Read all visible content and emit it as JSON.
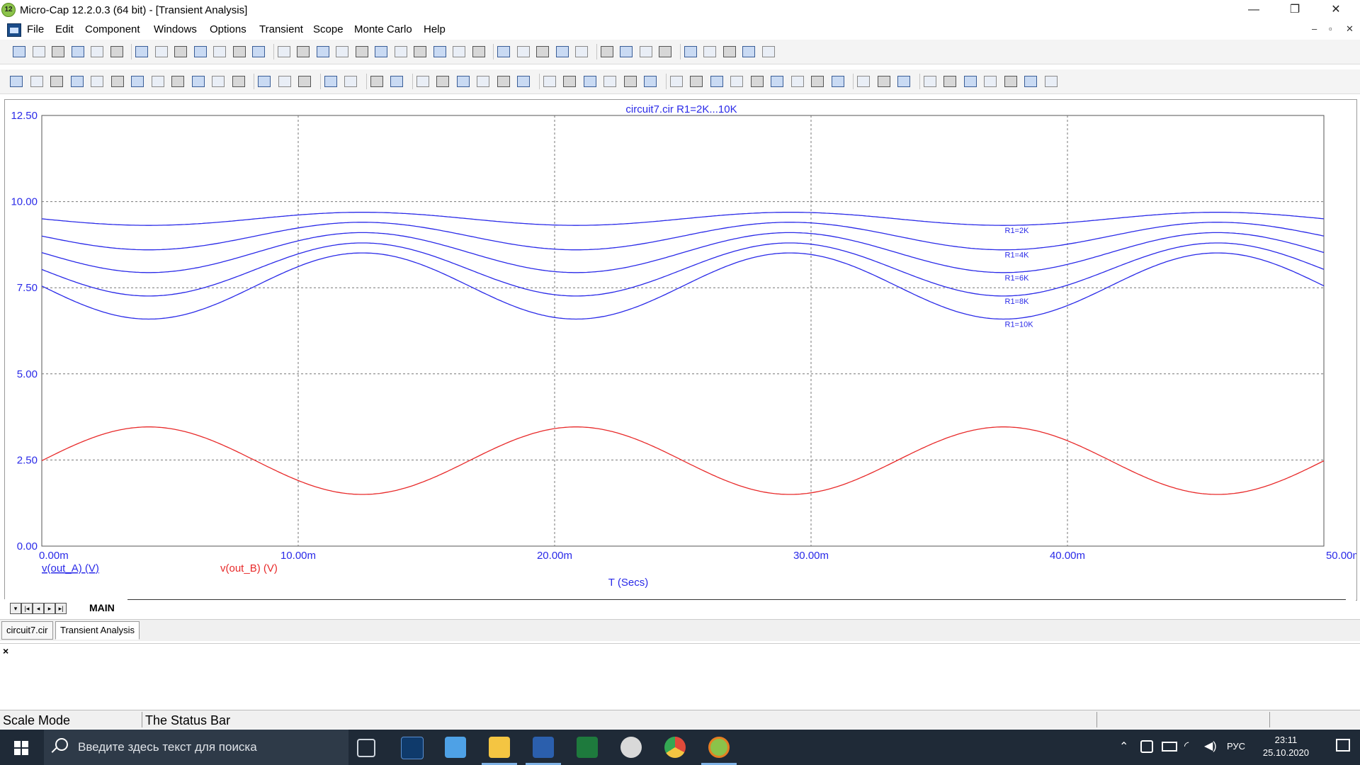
{
  "window": {
    "title": "Micro-Cap 12.2.0.3 (64 bit) - [Transient Analysis]",
    "app_badge": "12",
    "controls": {
      "minimize": "—",
      "restore": "❐",
      "close": "✕"
    }
  },
  "menu": {
    "items": [
      "File",
      "Edit",
      "Component",
      "Windows",
      "Options",
      "Transient",
      "Scope",
      "Monte Carlo",
      "Help"
    ],
    "mdi": {
      "minimize": "–",
      "restore": "▫",
      "close": "✕"
    }
  },
  "chart_data": {
    "type": "line",
    "title": "circuit7.cir R1=2K...10K",
    "xlabel": "T (Secs)",
    "x_ticks": [
      "0.00m",
      "10.00m",
      "20.00m",
      "30.00m",
      "40.00m",
      "50.00m"
    ],
    "y_ticks": [
      "0.00",
      "2.50",
      "5.00",
      "7.50",
      "10.00",
      "12.50"
    ],
    "xlim": [
      0,
      0.05
    ],
    "ylim": [
      0,
      12.5
    ],
    "grid": true,
    "colors": {
      "out_A": "#2a2ae8",
      "out_B": "#e82a2a",
      "text": "#2a2ae8"
    },
    "legend": [
      {
        "label": "v(out_A) (V)",
        "color": "#2a2ae8"
      },
      {
        "label": "v(out_B) (V)",
        "color": "#e82a2a"
      }
    ],
    "series": [
      {
        "name": "R1=2K",
        "expression": "v(out_A)",
        "mean": 9.5,
        "amplitude": 0.19,
        "x": [
          0,
          0.00417,
          0.0125,
          0.02083,
          0.02917,
          0.0375,
          0.04583,
          0.05
        ],
        "y": [
          9.5,
          9.31,
          9.69,
          9.31,
          9.69,
          9.31,
          9.69,
          9.5
        ]
      },
      {
        "name": "R1=4K",
        "expression": "v(out_A)",
        "mean": 9.0,
        "amplitude": 0.4,
        "x": [
          0,
          0.00417,
          0.0125,
          0.02083,
          0.02917,
          0.0375,
          0.04583,
          0.05
        ],
        "y": [
          9.0,
          8.6,
          9.4,
          8.6,
          9.4,
          8.6,
          9.4,
          9.0
        ]
      },
      {
        "name": "R1=6K",
        "expression": "v(out_A)",
        "mean": 8.52,
        "amplitude": 0.58,
        "x": [
          0,
          0.00417,
          0.0125,
          0.02083,
          0.02917,
          0.0375,
          0.04583,
          0.05
        ],
        "y": [
          8.52,
          7.94,
          9.1,
          7.94,
          9.1,
          7.94,
          9.1,
          8.52
        ]
      },
      {
        "name": "R1=8K",
        "expression": "v(out_A)",
        "mean": 8.03,
        "amplitude": 0.77,
        "x": [
          0,
          0.00417,
          0.0125,
          0.02083,
          0.02917,
          0.0375,
          0.04583,
          0.05
        ],
        "y": [
          8.03,
          7.26,
          8.8,
          7.26,
          8.8,
          7.26,
          8.8,
          8.03
        ]
      },
      {
        "name": "R1=10K",
        "expression": "v(out_A)",
        "mean": 7.55,
        "amplitude": 0.96,
        "x": [
          0,
          0.00417,
          0.0125,
          0.02083,
          0.02917,
          0.0375,
          0.04583,
          0.05
        ],
        "y": [
          7.55,
          6.59,
          8.51,
          6.59,
          8.51,
          6.59,
          8.51,
          7.55
        ]
      },
      {
        "name": "v(out_B)",
        "expression": "v(out_B)",
        "mean": 2.48,
        "amplitude": 0.98,
        "x": [
          0,
          0.00417,
          0.0125,
          0.02083,
          0.02917,
          0.0375,
          0.04583,
          0.05
        ],
        "y": [
          2.48,
          3.46,
          1.5,
          3.46,
          1.5,
          3.46,
          1.5,
          2.48
        ]
      }
    ],
    "period_s": 0.01667
  },
  "tabs": {
    "main_label": "MAIN",
    "documents": [
      "circuit7.cir",
      "Transient Analysis"
    ]
  },
  "output_pane": {
    "close": "×"
  },
  "status": {
    "mode": "Scale Mode",
    "message": "The Status Bar"
  },
  "taskbar": {
    "search_placeholder": "Введите здесь текст для поиска",
    "language": "РУС",
    "time": "23:11",
    "date": "25.10.2020"
  },
  "icons": {
    "toolbar1": [
      "new-file-icon",
      "open-icon",
      "save-icon",
      "save-all-icon",
      "print-preview-icon",
      "print-icon",
      "undo-icon",
      "redo-icon",
      "cut-icon",
      "copy-icon",
      "paste-icon",
      "delete-icon",
      "select-all-icon",
      "ground-icon",
      "resistor-icon",
      "capacitor-icon",
      "inductor-icon",
      "diode-icon",
      "transistor-icon",
      "battery-icon",
      "opamp-icon",
      "source-icon",
      "wire-icon",
      "node-icon",
      "probe-icon",
      "window-icon",
      "library-icon",
      "globe-icon",
      "component-icon",
      "text-icon",
      "settings-icon",
      "waveform-icon",
      "curve-icon",
      "tile-icon",
      "cascade-icon",
      "split-icon",
      "layout-icon",
      "calculator-icon"
    ],
    "toolbar2": [
      "select-arrow-icon",
      "pan-hand-icon",
      "rotate-icon",
      "image-icon",
      "scope-icon",
      "zoom-box-icon",
      "chart1-icon",
      "chart2-icon",
      "chart3-icon",
      "function-icon",
      "text-tool-icon",
      "properties-icon",
      "run-icon",
      "stop-icon",
      "pause-icon",
      "analysis-limits-icon",
      "plot-properties-icon",
      "grid-icon",
      "graph-icon",
      "panel1-icon",
      "panel2-icon",
      "panel3-icon",
      "panel4-icon",
      "h-split-icon",
      "v-split-icon",
      "zoom-in-icon",
      "zoom-out-icon",
      "zoom-fit-icon",
      "zoom-all-icon",
      "cursor-icon",
      "peak-icon",
      "valley-icon",
      "high-icon",
      "low-icon",
      "inflection-icon",
      "global-high-icon",
      "global-low-icon",
      "slope-icon",
      "top-icon",
      "bottom-icon",
      "clipboard-icon",
      "list-icon",
      "numbers-icon",
      "tokens-icon",
      "cursor-mode-icon",
      "font-size-icon",
      "font-icon",
      "color-icon",
      "overlay-icon",
      "stack-icon"
    ]
  }
}
